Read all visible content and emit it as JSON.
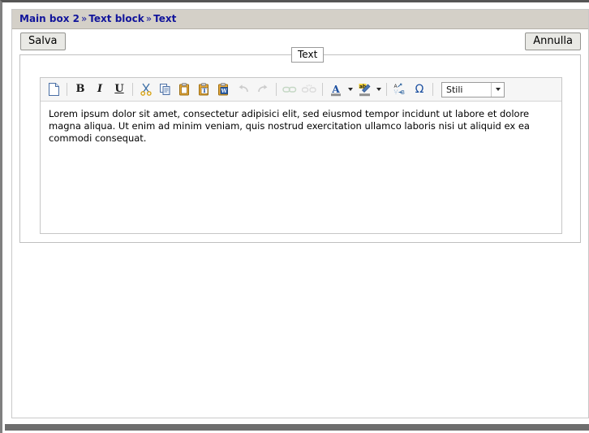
{
  "breadcrumb": {
    "items": [
      "Main box 2",
      "Text block",
      "Text"
    ],
    "separator": "»"
  },
  "actions": {
    "save_label": "Salva",
    "cancel_label": "Annulla"
  },
  "fieldset": {
    "legend": "Text"
  },
  "toolbar": {
    "groups": [
      {
        "buttons": [
          {
            "name": "new-page-icon",
            "glyph": "doc",
            "title": "Nuova pagina",
            "disabled": false
          }
        ]
      },
      {
        "buttons": [
          {
            "name": "bold-icon",
            "glyph": "B",
            "title": "Grassetto",
            "disabled": false
          },
          {
            "name": "italic-icon",
            "glyph": "I",
            "title": "Corsivo",
            "disabled": false
          },
          {
            "name": "underline-icon",
            "glyph": "U",
            "title": "Sottolineato",
            "disabled": false
          }
        ]
      },
      {
        "buttons": [
          {
            "name": "cut-icon",
            "glyph": "scissors",
            "title": "Taglia",
            "disabled": false
          },
          {
            "name": "copy-icon",
            "glyph": "copy",
            "title": "Copia",
            "disabled": false
          },
          {
            "name": "paste-icon",
            "glyph": "paste",
            "title": "Incolla",
            "disabled": false
          },
          {
            "name": "paste-as-plain-text-icon",
            "glyph": "paste-text",
            "title": "Incolla come testo semplice",
            "disabled": false
          },
          {
            "name": "paste-from-word-icon",
            "glyph": "paste-word",
            "title": "Incolla da Word",
            "disabled": false
          },
          {
            "name": "undo-icon",
            "glyph": "undo",
            "title": "Annulla",
            "disabled": true
          },
          {
            "name": "redo-icon",
            "glyph": "redo",
            "title": "Ripeti",
            "disabled": true
          }
        ]
      },
      {
        "buttons": [
          {
            "name": "link-icon",
            "glyph": "link",
            "title": "Inserisci/Modifica collegamento",
            "disabled": true
          },
          {
            "name": "unlink-icon",
            "glyph": "unlink",
            "title": "Elimina collegamento",
            "disabled": true
          }
        ]
      },
      {
        "buttons": [
          {
            "name": "text-color-icon",
            "glyph": "text-color",
            "title": "Colore testo",
            "disabled": false,
            "has_arrow": true
          },
          {
            "name": "background-color-icon",
            "glyph": "bg-color",
            "title": "Colore sfondo",
            "disabled": false,
            "has_arrow": true
          }
        ]
      },
      {
        "buttons": [
          {
            "name": "spell-check-icon",
            "glyph": "spellcheck",
            "title": "Controllo ortografico",
            "disabled": false
          },
          {
            "name": "special-character-icon",
            "glyph": "Ω",
            "title": "Inserisci carattere speciale",
            "disabled": false
          }
        ]
      }
    ],
    "styles_select": {
      "selected": "Stili",
      "options": [
        "Stili"
      ]
    }
  },
  "editor": {
    "content": "Lorem ipsum dolor sit amet, consectetur adipisici elit, sed eiusmod tempor incidunt ut labore et dolore magna aliqua. Ut enim ad minim veniam, quis nostrud exercitation ullamco laboris nisi ut aliquid ex ea commodi consequat."
  },
  "colors": {
    "breadcrumb_link": "#12159b",
    "breadcrumb_bar_bg": "#d4d0c8",
    "toolbar_bg": "#f6f6f6",
    "page_bg": "#ffffff",
    "border": "#c0c0c0"
  }
}
